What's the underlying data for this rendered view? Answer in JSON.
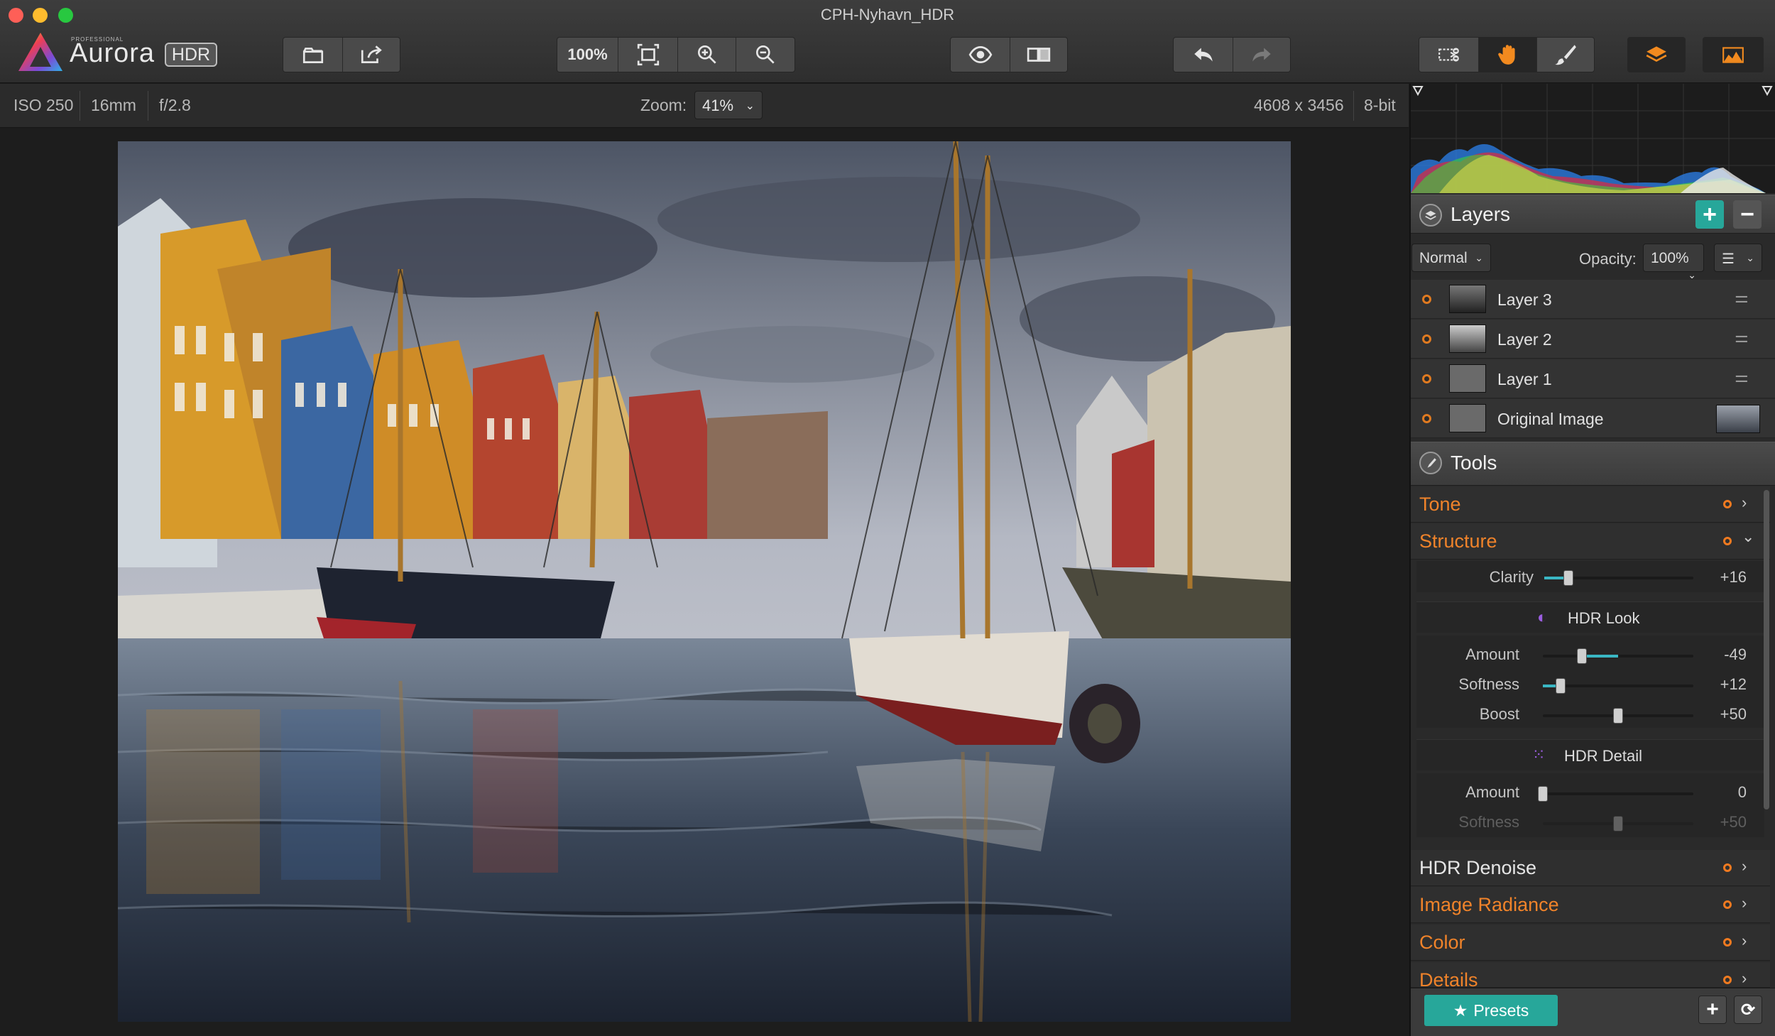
{
  "window": {
    "title": "CPH-Nyhavn_HDR"
  },
  "logo": {
    "small": "PROFESSIONAL",
    "word": "Aurora",
    "badge": "HDR"
  },
  "toolbar": {
    "zoom_100": "100%"
  },
  "info": {
    "iso": "ISO 250",
    "focal": "16mm",
    "aperture": "f/2.8",
    "zoom_label": "Zoom:",
    "zoom_value": "41%",
    "dimensions": "4608 x 3456",
    "bitdepth": "8-bit"
  },
  "layers": {
    "title": "Layers",
    "blend_mode": "Normal",
    "opacity_label": "Opacity:",
    "opacity_value": "100%",
    "items": [
      {
        "name": "Layer 3"
      },
      {
        "name": "Layer 2"
      },
      {
        "name": "Layer 1"
      },
      {
        "name": "Original Image"
      }
    ]
  },
  "tools": {
    "title": "Tools",
    "tone": "Tone",
    "structure": "Structure",
    "clarity": {
      "label": "Clarity",
      "value": "+16",
      "pos": 0.16
    },
    "hdr_look": {
      "title": "HDR Look",
      "amount": {
        "label": "Amount",
        "value": "-49",
        "pos": 0.26
      },
      "softness": {
        "label": "Softness",
        "value": "+12",
        "pos": 0.12
      },
      "boost": {
        "label": "Boost",
        "value": "+50",
        "pos": 0.5
      }
    },
    "hdr_detail": {
      "title": "HDR Detail",
      "amount": {
        "label": "Amount",
        "value": "0",
        "pos": 0.0
      },
      "softness": {
        "label": "Softness",
        "value": "+50",
        "pos": 0.5
      }
    },
    "hdr_denoise": "HDR Denoise",
    "image_radiance": "Image Radiance",
    "color": "Color",
    "details": "Details"
  },
  "footer": {
    "presets": "Presets"
  },
  "colors": {
    "accent": "#27a79a",
    "orange": "#f0832a"
  }
}
